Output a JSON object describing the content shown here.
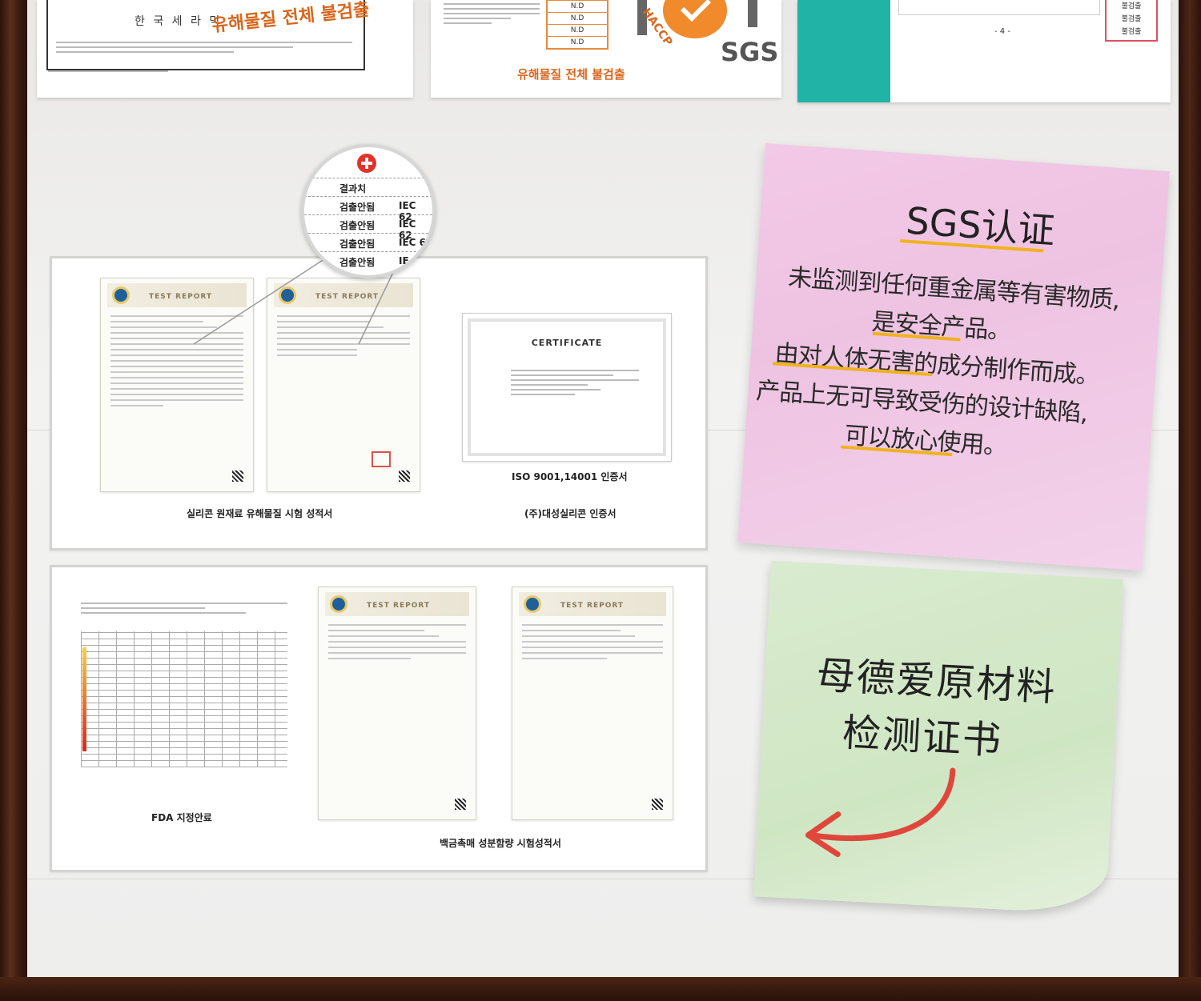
{
  "top_docs": {
    "doc1_header": "한 국 세 라 믹",
    "doc1_overlay": "유해물질 전체 불검출",
    "doc2_nd": [
      "N.D",
      "N.D",
      "N.D",
      "N.D"
    ],
    "doc2_caption": "유해물질 전체 불검출",
    "doc2_haccp": "HACCP",
    "doc2_sgs": "SGS",
    "doc3_page": "- 4 -",
    "doc3_labels": [
      "불검출",
      "불검출",
      "불검출"
    ]
  },
  "magnifier": {
    "header": "결과치",
    "rows": [
      {
        "label": "검출안됨",
        "ref": "IEC 62"
      },
      {
        "label": "검출안됨",
        "ref": "IEC 62"
      },
      {
        "label": "검출안됨",
        "ref": "IEC 6"
      },
      {
        "label": "검출안됨",
        "ref": "IE"
      }
    ]
  },
  "panel1": {
    "report_title": "TEST REPORT",
    "cert_title": "CERTIFICATE",
    "cert_caption": "ISO 9001,14001 인증서",
    "caption_left": "실리콘 원재료 유해물질 시험 성적서",
    "caption_right": "(주)대성실리콘 인증서"
  },
  "panel2": {
    "report_title": "TEST REPORT",
    "caption_left": "FDA 지정안료",
    "caption_right": "백금촉매 성분함량 시험성적서"
  },
  "note_pink": {
    "title": "SGS认证",
    "lines": [
      "未监测到任何重金属等有害物质,",
      "是安全产品。",
      "由对人体无害的成分制作而成。",
      "产品上无可导致受伤的设计缺陷,",
      "可以放心使用。"
    ],
    "highlight_color": "#f0b21e"
  },
  "note_green": {
    "title_line1": "母德爱原材料",
    "title_line2": "检测证书",
    "arrow_color": "#e0473c"
  }
}
